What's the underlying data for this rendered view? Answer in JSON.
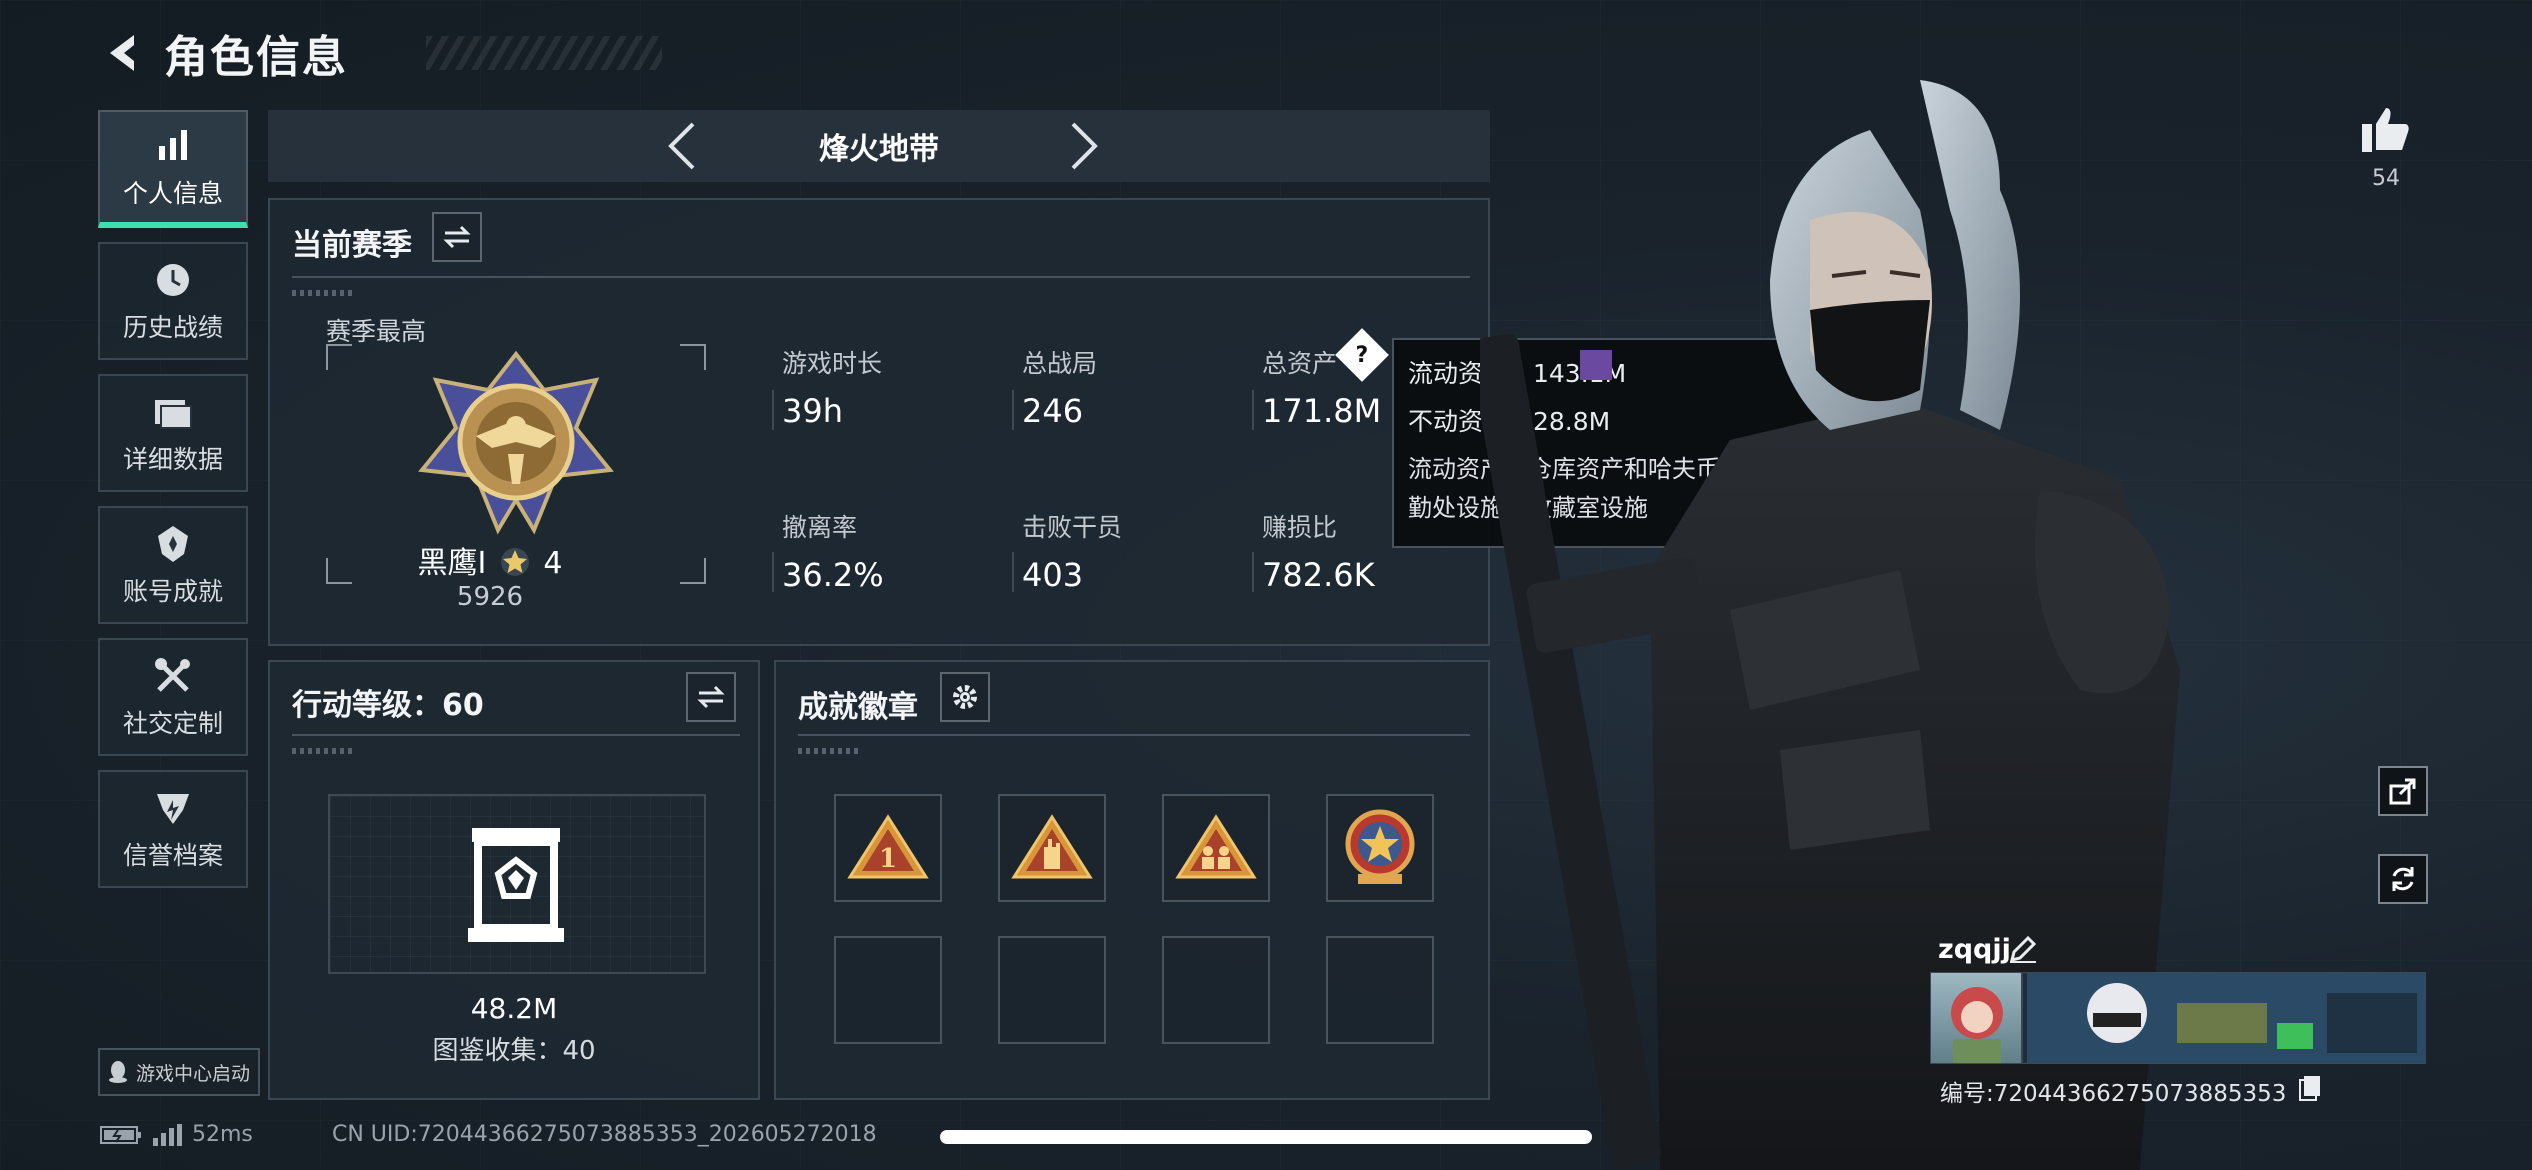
{
  "header": {
    "title": "角色信息"
  },
  "sidebar": {
    "items": [
      {
        "label": "个人信息",
        "icon": "bar-chart-icon",
        "active": true
      },
      {
        "label": "历史战绩",
        "icon": "clock-icon",
        "active": false
      },
      {
        "label": "详细数据",
        "icon": "folder-icon",
        "active": false
      },
      {
        "label": "账号成就",
        "icon": "medal-icon",
        "active": false
      },
      {
        "label": "社交定制",
        "icon": "tools-icon",
        "active": false
      },
      {
        "label": "信誉档案",
        "icon": "reputation-icon",
        "active": false
      }
    ],
    "launch_label": "游戏中心启动"
  },
  "mode": {
    "title": "烽火地带"
  },
  "season": {
    "title": "当前赛季",
    "best_label": "赛季最高",
    "rank_name": "黑鹰I",
    "rank_stars": "4",
    "rank_score": "5926",
    "stats": [
      {
        "label": "游戏时长",
        "value": "39h"
      },
      {
        "label": "总战局",
        "value": "246"
      },
      {
        "label": "总资产",
        "value": "171.8M"
      },
      {
        "label": "撤离率",
        "value": "36.2%"
      },
      {
        "label": "击败干员",
        "value": "403"
      },
      {
        "label": "赚损比",
        "value": "782.6K"
      }
    ]
  },
  "tooltip": {
    "liquid": "流动资产：143.1M",
    "fixed": "不动资产：28.8M",
    "note": "流动资产为仓库资产和哈夫币，不动资产为特勤处设施和收藏室设施"
  },
  "level": {
    "title": "行动等级：60",
    "vault_value": "48.2M",
    "collection": "图鉴收集：40"
  },
  "badges": {
    "title": "成就徽章"
  },
  "right": {
    "likes": "54",
    "player_name": "zqqjj",
    "player_id": "编号:72044366275073885353"
  },
  "status": {
    "ping": "52ms",
    "uid": "CN UID:72044366275073885353_202605272018"
  },
  "colors": {
    "accent": "#3fe0b0",
    "panel": "#1f2932",
    "border": "#3a4651"
  }
}
